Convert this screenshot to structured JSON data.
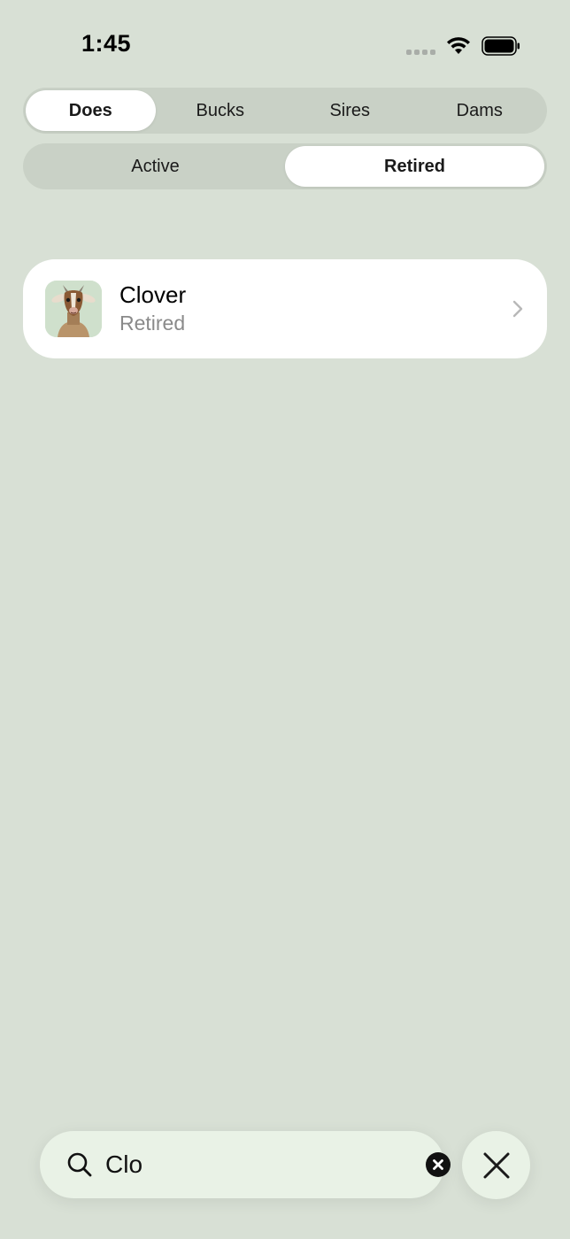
{
  "status_bar": {
    "time": "1:45"
  },
  "animal_tabs": {
    "items": [
      {
        "label": "Does",
        "selected": true
      },
      {
        "label": "Bucks",
        "selected": false
      },
      {
        "label": "Sires",
        "selected": false
      },
      {
        "label": "Dams",
        "selected": false
      }
    ]
  },
  "status_tabs": {
    "items": [
      {
        "label": "Active",
        "selected": false
      },
      {
        "label": "Retired",
        "selected": true
      }
    ]
  },
  "results": [
    {
      "name": "Clover",
      "status": "Retired",
      "avatar_icon": "goat-avatar-icon"
    }
  ],
  "search": {
    "value": "Clo",
    "icon": "search-icon",
    "clear_icon": "clear-circle-icon"
  },
  "close": {
    "icon": "close-icon"
  },
  "colors": {
    "background": "#d8e0d5",
    "segment_track": "#c9d1c6",
    "selected_segment": "#ffffff",
    "card": "#ffffff",
    "subtitle": "#8a8a8a",
    "search_bg": "#e9f2e6"
  }
}
